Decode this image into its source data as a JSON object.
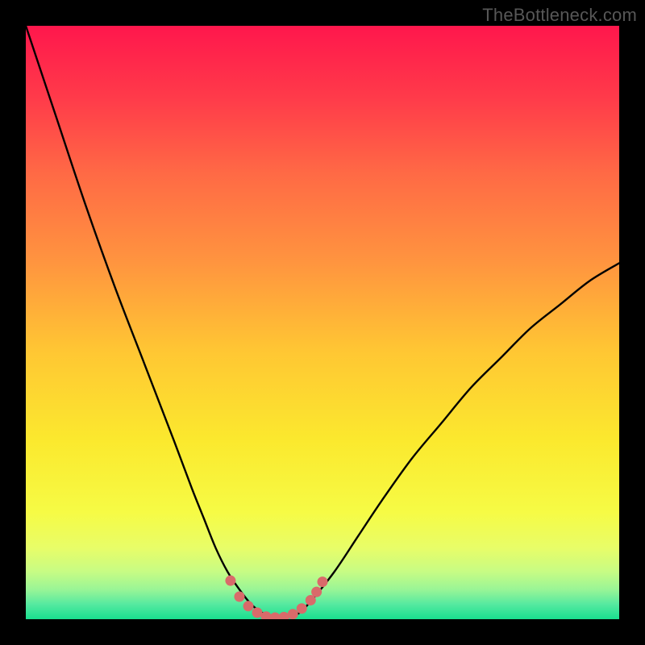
{
  "watermark": "TheBottleneck.com",
  "chart_data": {
    "type": "line",
    "title": "",
    "xlabel": "",
    "ylabel": "",
    "xlim": [
      0,
      100
    ],
    "ylim": [
      0,
      100
    ],
    "series": [
      {
        "name": "bottleneck-curve",
        "x": [
          0,
          5,
          10,
          15,
          20,
          25,
          28,
          30,
          32,
          34,
          36,
          38,
          40,
          42,
          44,
          46,
          48,
          52,
          56,
          60,
          65,
          70,
          75,
          80,
          85,
          90,
          95,
          100
        ],
        "y": [
          100,
          85,
          70,
          56,
          43,
          30,
          22,
          17,
          12,
          8,
          5,
          2.5,
          1,
          0.3,
          0.3,
          1,
          3,
          8,
          14,
          20,
          27,
          33,
          39,
          44,
          49,
          53,
          57,
          60
        ]
      }
    ],
    "markers": {
      "name": "sweet-spot-markers",
      "color": "#d96a6a",
      "x": [
        34.5,
        36,
        37.5,
        39,
        40.5,
        42,
        43.5,
        45,
        46.5,
        48,
        49,
        50
      ],
      "y": [
        6.5,
        3.8,
        2.2,
        1.1,
        0.45,
        0.28,
        0.35,
        0.85,
        1.8,
        3.2,
        4.6,
        6.3
      ]
    },
    "gradient_stops": [
      {
        "offset": 0.0,
        "color": "#ff174c"
      },
      {
        "offset": 0.12,
        "color": "#ff3a4a"
      },
      {
        "offset": 0.25,
        "color": "#ff6a45"
      },
      {
        "offset": 0.4,
        "color": "#ff953f"
      },
      {
        "offset": 0.55,
        "color": "#ffc733"
      },
      {
        "offset": 0.7,
        "color": "#fbe92e"
      },
      {
        "offset": 0.82,
        "color": "#f6fb45"
      },
      {
        "offset": 0.88,
        "color": "#e8fd68"
      },
      {
        "offset": 0.92,
        "color": "#c7fc84"
      },
      {
        "offset": 0.95,
        "color": "#99f596"
      },
      {
        "offset": 0.975,
        "color": "#55e9a0"
      },
      {
        "offset": 1.0,
        "color": "#19df8f"
      }
    ]
  }
}
